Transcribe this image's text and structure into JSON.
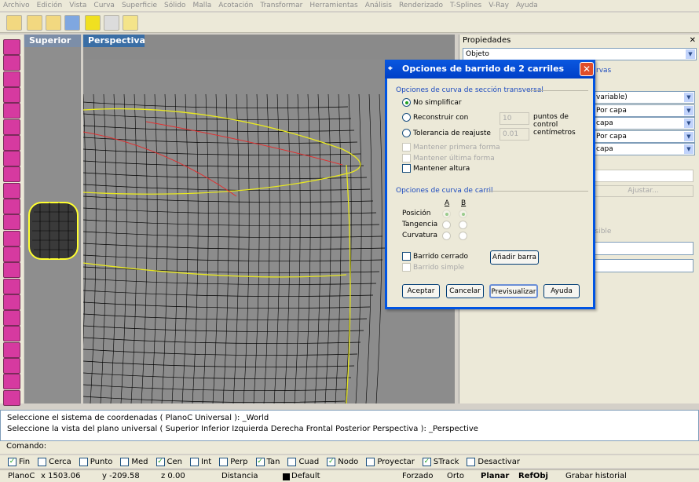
{
  "menu": [
    "Archivo",
    "Edición",
    "Vista",
    "Curva",
    "Superficie",
    "Sólido",
    "Malla",
    "Acotación",
    "Transformar",
    "Herramientas",
    "Análisis",
    "Renderizado",
    "T-Splines",
    "V-Ray",
    "Ayuda"
  ],
  "viewports": {
    "top": "Superior",
    "persp": "Perspectiva"
  },
  "panel": {
    "title": "Propiedades",
    "object": "Objeto",
    "curves_tab": "rvas",
    "rows": [
      "variable)",
      "Por capa",
      "capa",
      "Por capa",
      "capa"
    ],
    "adjust": "Ajustar...",
    "visible": "isible"
  },
  "dialog": {
    "title": "Opciones de barrido de 2 carriles",
    "sec1": "Opciones de curva de sección transversal",
    "opt_nosimp": "No simplificar",
    "opt_rebuild": "Reconstruir con",
    "rebuild_val": "10",
    "rebuild_unit": "puntos de control",
    "opt_tol": "Tolerancia de reajuste",
    "tol_val": "0.01",
    "tol_unit": "centímetros",
    "keep_first": "Mantener primera forma",
    "keep_last": "Mantener última forma",
    "keep_height": "Mantener altura",
    "sec2": "Opciones de curva de carril",
    "col_a": "A",
    "col_b": "B",
    "r_pos": "Posición",
    "r_tan": "Tangencia",
    "r_curv": "Curvatura",
    "closed": "Barrido cerrado",
    "simple": "Barrido simple",
    "add_bar": "Añadir barra",
    "ok": "Aceptar",
    "cancel": "Cancelar",
    "preview": "Previsualizar",
    "help": "Ayuda"
  },
  "history": [
    "Seleccione el sistema de coordenadas ( PlanoC  Universal ): _World",
    "Seleccione la vista del plano universal ( Superior  Inferior  Izquierda  Derecha  Frontal  Posterior  Perspectiva ): _Perspective"
  ],
  "command_label": "Comando:",
  "osnaps": [
    {
      "label": "Fin",
      "on": true
    },
    {
      "label": "Cerca",
      "on": false
    },
    {
      "label": "Punto",
      "on": false
    },
    {
      "label": "Med",
      "on": false
    },
    {
      "label": "Cen",
      "on": true
    },
    {
      "label": "Int",
      "on": false
    },
    {
      "label": "Perp",
      "on": false
    },
    {
      "label": "Tan",
      "on": true
    },
    {
      "label": "Cuad",
      "on": false
    },
    {
      "label": "Nodo",
      "on": true
    },
    {
      "label": "Proyectar",
      "on": false
    },
    {
      "label": "STrack",
      "on": true
    },
    {
      "label": "Desactivar",
      "on": false
    }
  ],
  "status": {
    "plane": "PlanoC",
    "x": "x 1503.06",
    "y": "y -209.58",
    "z": "z 0.00",
    "dist": "Distancia",
    "layer": "Default",
    "forced": "Forzado",
    "orto": "Orto",
    "planar": "Planar",
    "refobj": "RefObj",
    "hist": "Grabar historial"
  }
}
